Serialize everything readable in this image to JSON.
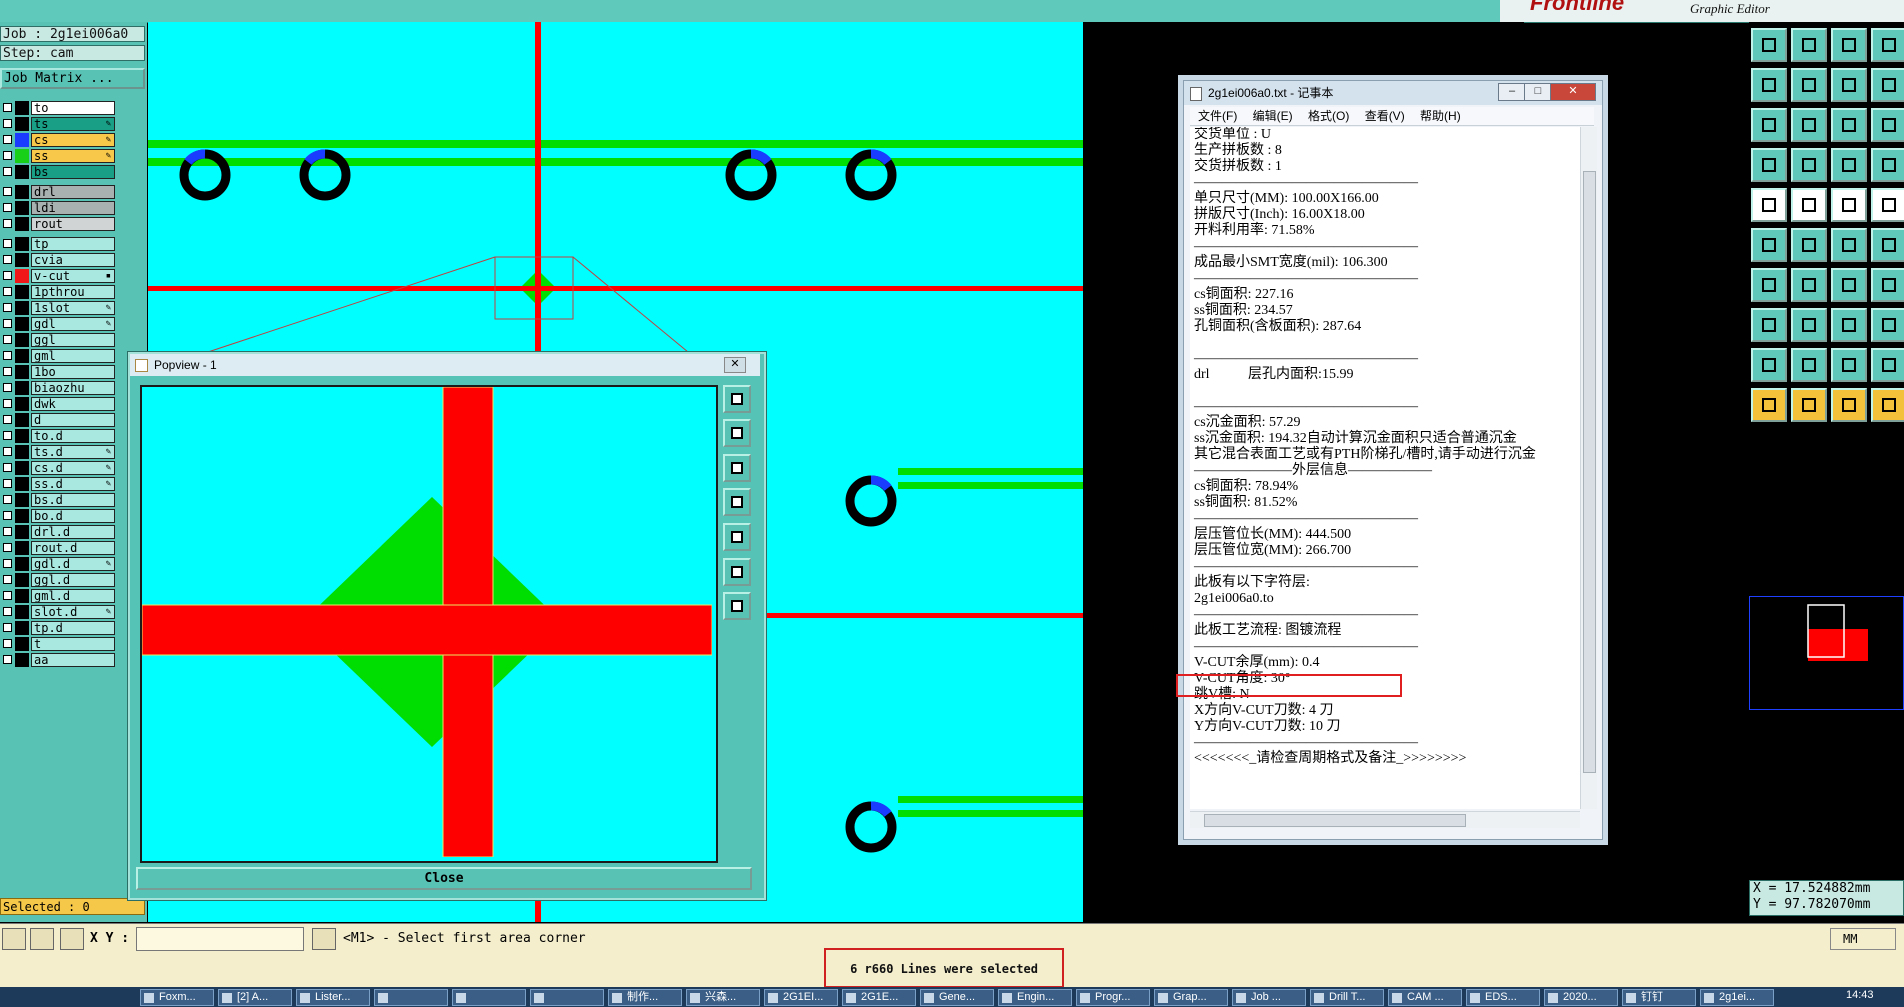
{
  "brand": {
    "logo": "Frontline",
    "subtitle": "Graphic Editor"
  },
  "job": {
    "job_label": "Job : 2g1ei006a0",
    "step_label": "Step: cam",
    "matrix_button": "Job Matrix ..."
  },
  "layers": [
    {
      "name": "to",
      "color": "#000000",
      "bg": "#ffffff",
      "mark": ""
    },
    {
      "name": "ts",
      "color": "#000000",
      "bg": "#189f86",
      "mark": "✎"
    },
    {
      "name": "cs",
      "color": "#1a3cff",
      "bg": "#f8c84a",
      "mark": "✎"
    },
    {
      "name": "ss",
      "color": "#18d018",
      "bg": "#f8c84a",
      "mark": "✎"
    },
    {
      "name": "bs",
      "color": "#000000",
      "bg": "#189f86",
      "mark": ""
    },
    {
      "name": "drl",
      "color": "#000000",
      "bg": "#a8b0b0",
      "mark": ""
    },
    {
      "name": "ldi",
      "color": "#000000",
      "bg": "#a8b0b0",
      "mark": ""
    },
    {
      "name": "rout",
      "color": "#000000",
      "bg": "#d0d4d4",
      "mark": ""
    },
    {
      "name": "tp",
      "color": "#000000",
      "bg": "#a8e8e0",
      "mark": ""
    },
    {
      "name": "cvia",
      "color": "#000000",
      "bg": "#a8e8e0",
      "mark": ""
    },
    {
      "name": "v-cut",
      "color": "#f01818",
      "bg": "#a8e8e0",
      "mark": "▪"
    },
    {
      "name": "1pthrou",
      "color": "#000000",
      "bg": "#a8e8e0",
      "mark": ""
    },
    {
      "name": "1slot",
      "color": "#000000",
      "bg": "#a8e8e0",
      "mark": "✎"
    },
    {
      "name": "gdl",
      "color": "#000000",
      "bg": "#a8e8e0",
      "mark": "✎"
    },
    {
      "name": "ggl",
      "color": "#000000",
      "bg": "#a8e8e0",
      "mark": ""
    },
    {
      "name": "gml",
      "color": "#000000",
      "bg": "#a8e8e0",
      "mark": ""
    },
    {
      "name": "1bo",
      "color": "#000000",
      "bg": "#a8e8e0",
      "mark": ""
    },
    {
      "name": "biaozhu",
      "color": "#000000",
      "bg": "#a8e8e0",
      "mark": ""
    },
    {
      "name": "dwk",
      "color": "#000000",
      "bg": "#a8e8e0",
      "mark": ""
    },
    {
      "name": "d",
      "color": "#000000",
      "bg": "#a8e8e0",
      "mark": ""
    },
    {
      "name": "to.d",
      "color": "#000000",
      "bg": "#a8e8e0",
      "mark": ""
    },
    {
      "name": "ts.d",
      "color": "#000000",
      "bg": "#a8e8e0",
      "mark": "✎"
    },
    {
      "name": "cs.d",
      "color": "#000000",
      "bg": "#a8e8e0",
      "mark": "✎"
    },
    {
      "name": "ss.d",
      "color": "#000000",
      "bg": "#a8e8e0",
      "mark": "✎"
    },
    {
      "name": "bs.d",
      "color": "#000000",
      "bg": "#a8e8e0",
      "mark": ""
    },
    {
      "name": "bo.d",
      "color": "#000000",
      "bg": "#a8e8e0",
      "mark": ""
    },
    {
      "name": "drl.d",
      "color": "#000000",
      "bg": "#a8e8e0",
      "mark": ""
    },
    {
      "name": "rout.d",
      "color": "#000000",
      "bg": "#a8e8e0",
      "mark": ""
    },
    {
      "name": "gdl.d",
      "color": "#000000",
      "bg": "#a8e8e0",
      "mark": "✎"
    },
    {
      "name": "ggl.d",
      "color": "#000000",
      "bg": "#a8e8e0",
      "mark": ""
    },
    {
      "name": "gml.d",
      "color": "#000000",
      "bg": "#a8e8e0",
      "mark": ""
    },
    {
      "name": "slot.d",
      "color": "#000000",
      "bg": "#a8e8e0",
      "mark": "✎"
    },
    {
      "name": "tp.d",
      "color": "#000000",
      "bg": "#a8e8e0",
      "mark": ""
    },
    {
      "name": "t",
      "color": "#000000",
      "bg": "#a8e8e0",
      "mark": ""
    },
    {
      "name": "aa",
      "color": "#000000",
      "bg": "#a8e8e0",
      "mark": ""
    }
  ],
  "selected_label": "Selected : 0",
  "popview": {
    "title": "Popview - 1",
    "close_label": "Close"
  },
  "notepad": {
    "title": "2g1ei006a0.txt - 记事本",
    "menu": [
      "文件(F)",
      "编辑(E)",
      "格式(O)",
      "查看(V)",
      "帮助(H)"
    ],
    "lines": [
      "交货单位 : U",
      "生产拼板数 : 8",
      "交货拼板数 : 1",
      "————————————————",
      "单只尺寸(MM): 100.00X166.00",
      "拼版尺寸(Inch): 16.00X18.00",
      "开料利用率: 71.58%",
      "————————————————",
      "成品最小SMT宽度(mil): 106.300",
      "————————————————",
      "cs铜面积: 227.16",
      "ss铜面积: 234.57",
      "孔铜面积(含板面积): 287.64",
      "",
      "————————————————",
      "drl           层孔内面积:15.99",
      "",
      "————————————————",
      "cs沉金面积: 57.29",
      "ss沉金面积: 194.32自动计算沉金面积只适合普通沉金",
      "其它混合表面工艺或有PTH阶梯孔/槽时,请手动进行沉金",
      "———————外层信息——————",
      "cs铜面积: 78.94%",
      "ss铜面积: 81.52%",
      "————————————————",
      "层压管位长(MM): 444.500",
      "层压管位宽(MM): 266.700",
      "————————————————",
      "此板有以下字符层:",
      "2g1ei006a0.to",
      "————————————————",
      "此板工艺流程: 图镀流程",
      "————————————————",
      "V-CUT余厚(mm): 0.4",
      "V-CUT角度: 30°",
      "跳V槽: N",
      "X方向V-CUT刀数: 4 刀",
      "Y方向V-CUT刀数: 10 刀",
      "————————————————",
      "<<<<<<<_请检查周期格式及备注_>>>>>>>>"
    ]
  },
  "coords": {
    "x": "X = 17.524882mm",
    "y": "Y = 97.782070mm"
  },
  "command": {
    "xy_label": "X Y :",
    "prompt": "<M1> - Select first area corner",
    "units": "MM"
  },
  "status_message": "6 r660 Lines were selected",
  "taskbar": {
    "items": [
      "Foxm...",
      "[2] A...",
      "Lister...",
      "",
      "",
      "",
      "制作...",
      "兴森...",
      "2G1EI...",
      "2G1E...",
      "Gene...",
      "Engin...",
      "Progr...",
      "Grap...",
      "Job ...",
      "Drill T...",
      "CAM ...",
      "EDS...",
      "2020...",
      "钉钉",
      "2g1ei..."
    ],
    "clock": "14:43"
  },
  "colors": {
    "cyan_bg": "#00ffff",
    "trace_red": "#ff0000",
    "copper_green": "#00dd00",
    "pad_blue": "#1a3cff"
  }
}
